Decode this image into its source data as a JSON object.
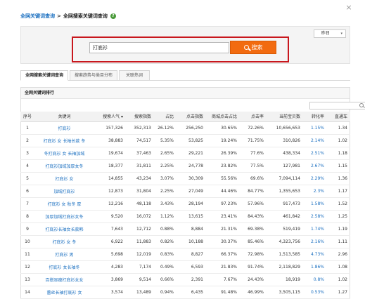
{
  "breadcrumb": {
    "root": "全网关键词查询",
    "sep": ">",
    "current": "全网搜索关键词查询",
    "help": "?"
  },
  "close_glyph": "×",
  "date_select": {
    "value": "昨日",
    "caret": "▾"
  },
  "search": {
    "value": "打底衫",
    "button_label": "搜索"
  },
  "tabs": [
    "全网搜索关键词查询",
    "搜索趋势与类目分布",
    "关联热词"
  ],
  "section_title": "全网关键词排行",
  "table": {
    "columns": [
      "序号",
      "关键词",
      "搜索人气 ▾",
      "搜索指数",
      "占比",
      "点击指数",
      "商城点击占比",
      "点击率",
      "当前宝贝数",
      "转化率",
      "直通车"
    ],
    "rows": [
      [
        "1",
        "打底衫",
        "157,326",
        "352,313",
        "26.12%",
        "256,250",
        "30.65%",
        "72.26%",
        "10,656,653",
        "1.15%",
        "1.34"
      ],
      [
        "2",
        "打底衫 女 长袖长款 冬",
        "38,883",
        "74,517",
        "5.35%",
        "53,825",
        "19.24%",
        "71.75%",
        "310,826",
        "2.14%",
        "1.02"
      ],
      [
        "3",
        "冬打底衫 女 长袖加绒",
        "19,674",
        "37,463",
        "2.65%",
        "29,221",
        "26.39%",
        "77.6%",
        "438,334",
        "2.51%",
        "1.18"
      ],
      [
        "4",
        "打底衫加绒加厚女冬",
        "18,377",
        "31,811",
        "2.25%",
        "24,778",
        "23.82%",
        "77.5%",
        "127,981",
        "2.67%",
        "1.15"
      ],
      [
        "5",
        "打底衫 女",
        "14,855",
        "43,234",
        "3.07%",
        "30,309",
        "55.56%",
        "69.6%",
        "7,094,114",
        "2.29%",
        "1.36"
      ],
      [
        "6",
        "加绒打底衫",
        "12,873",
        "31,804",
        "2.25%",
        "27,049",
        "44.46%",
        "84.77%",
        "1,355,653",
        "2.3%",
        "1.17"
      ],
      [
        "7",
        "打底衫 女 秋冬 厚",
        "12,216",
        "48,118",
        "3.43%",
        "28,194",
        "97.23%",
        "57.96%",
        "917,473",
        "1.58%",
        "1.52"
      ],
      [
        "8",
        "加厚加绒打底衫女冬",
        "9,520",
        "16,072",
        "1.12%",
        "13,615",
        "23.41%",
        "84.43%",
        "461,842",
        "2.58%",
        "1.25"
      ],
      [
        "9",
        "打底衫长袖女长款韩",
        "7,643",
        "12,712",
        "0.88%",
        "8,884",
        "21.31%",
        "69.38%",
        "519,419",
        "1.74%",
        "1.19"
      ],
      [
        "10",
        "打底衫 女 冬",
        "6,922",
        "11,883",
        "0.82%",
        "10,188",
        "30.37%",
        "85.46%",
        "4,323,756",
        "2.16%",
        "1.11"
      ],
      [
        "11",
        "打底衫 男",
        "5,698",
        "12,019",
        "0.83%",
        "8,827",
        "66.37%",
        "72.98%",
        "1,513,585",
        "4.73%",
        "2.96"
      ],
      [
        "12",
        "打底衫 女长袖冬",
        "4,283",
        "7,174",
        "0.49%",
        "6,593",
        "21.83%",
        "91.74%",
        "2,118,829",
        "1.86%",
        "1.08"
      ],
      [
        "13",
        "百搭显瘦打底衫女女",
        "3,869",
        "9,514",
        "0.66%",
        "2,391",
        "7.67%",
        "24.43%",
        "18,919",
        "0.8%",
        "1.02"
      ],
      [
        "14",
        "蕾丝长袖打底衫 女",
        "3,574",
        "13,489",
        "0.94%",
        "6,435",
        "91.48%",
        "46.99%",
        "3,505,115",
        "0.53%",
        "1.27"
      ],
      [
        "15",
        "打底衫 加绒 女",
        "3,350",
        "9,929",
        "0.68%",
        "7,928",
        "47.92%",
        "79.48%",
        "1,359,225",
        "2.91%",
        "1.3"
      ]
    ]
  },
  "colors": {
    "accent_orange": "#f26b10",
    "highlight_red": "#c8171d",
    "link_blue": "#1a6fc0"
  }
}
